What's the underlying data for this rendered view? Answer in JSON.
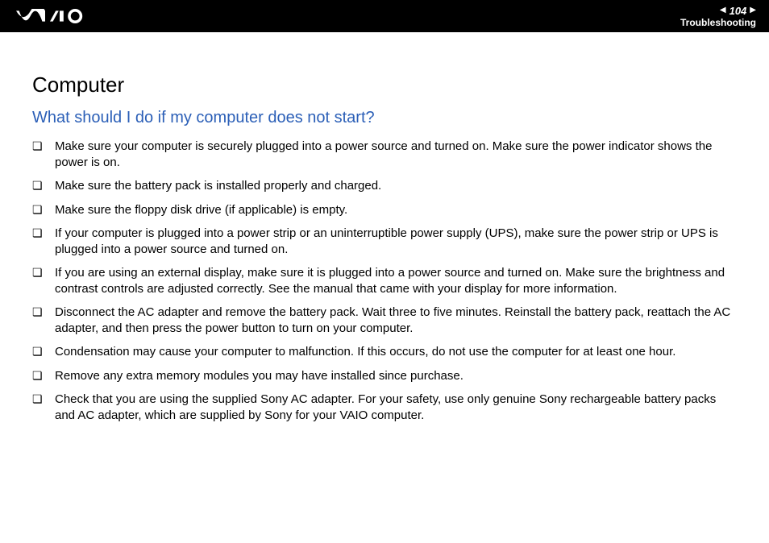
{
  "header": {
    "page_number": "104",
    "section": "Troubleshooting"
  },
  "content": {
    "heading": "Computer",
    "subheading": "What should I do if my computer does not start?",
    "bullets": [
      "Make sure your computer is securely plugged into a power source and turned on. Make sure the power indicator shows the power is on.",
      "Make sure the battery pack is installed properly and charged.",
      "Make sure the floppy disk drive (if applicable) is empty.",
      "If your computer is plugged into a power strip or an uninterruptible power supply (UPS), make sure the power strip or UPS is plugged into a power source and turned on.",
      "If you are using an external display, make sure it is plugged into a power source and turned on. Make sure the brightness and contrast controls are adjusted correctly. See the manual that came with your display for more information.",
      "Disconnect the AC adapter and remove the battery pack. Wait three to five minutes. Reinstall the battery pack, reattach the AC adapter, and then press the power button to turn on your computer.",
      "Condensation may cause your computer to malfunction. If this occurs, do not use the computer for at least one hour.",
      "Remove any extra memory modules you may have installed since purchase.",
      "Check that you are using the supplied Sony AC adapter. For your safety, use only genuine Sony rechargeable battery packs and AC adapter, which are supplied by Sony for your VAIO computer."
    ]
  }
}
